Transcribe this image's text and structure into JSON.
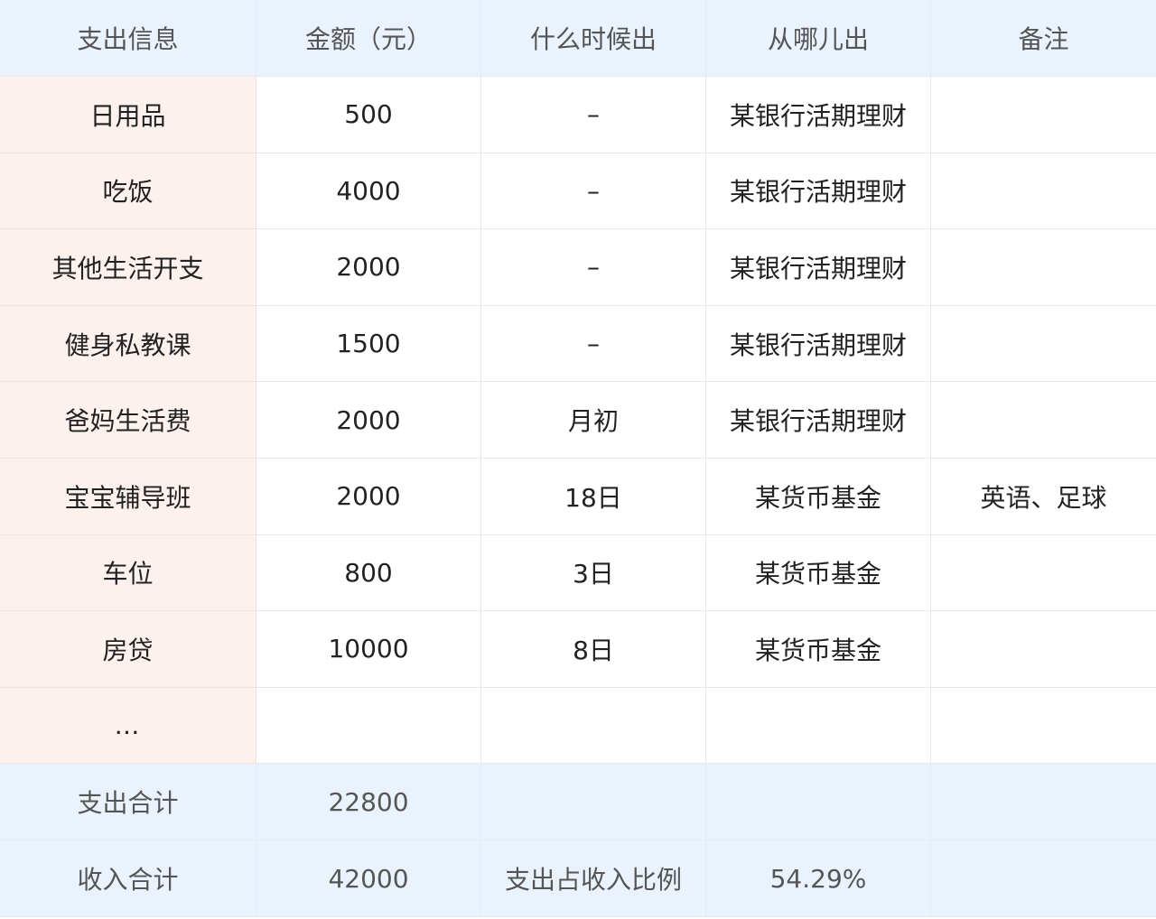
{
  "header": [
    "支出信息",
    "金额（元）",
    "什么时候出",
    "从哪儿出",
    "备注"
  ],
  "rows": [
    [
      "日用品",
      "500",
      "–",
      "某银行活期理财",
      ""
    ],
    [
      "吃饭",
      "4000",
      "–",
      "某银行活期理财",
      ""
    ],
    [
      "其他生活开支",
      "2000",
      "–",
      "某银行活期理财",
      ""
    ],
    [
      "健身私教课",
      "1500",
      "–",
      "某银行活期理财",
      ""
    ],
    [
      "爸妈生活费",
      "2000",
      "月初",
      "某银行活期理财",
      ""
    ],
    [
      "宝宝辅导班",
      "2000",
      "18日",
      "某货币基金",
      "英语、足球"
    ],
    [
      "车位",
      "800",
      "3日",
      "某货币基金",
      ""
    ],
    [
      "房贷",
      "10000",
      "8日",
      "某货币基金",
      ""
    ],
    [
      "…",
      "",
      "",
      "",
      ""
    ]
  ],
  "footer": [
    [
      "支出合计",
      "22800",
      "",
      "",
      ""
    ],
    [
      "收入合计",
      "42000",
      "支出占收入比例",
      "54.29%",
      ""
    ]
  ]
}
